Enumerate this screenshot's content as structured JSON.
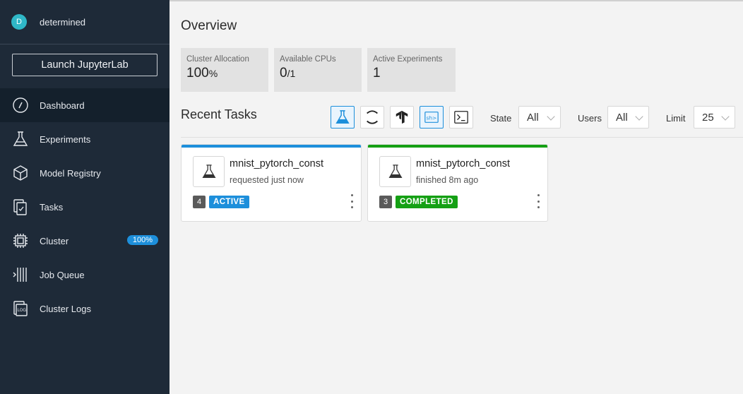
{
  "user": {
    "initial": "D",
    "name": "determined"
  },
  "launch_button": "Launch JupyterLab",
  "nav": [
    {
      "label": "Dashboard",
      "icon": "dashboard-icon",
      "active": true
    },
    {
      "label": "Experiments",
      "icon": "flask-icon"
    },
    {
      "label": "Model Registry",
      "icon": "cube-icon"
    },
    {
      "label": "Tasks",
      "icon": "tasks-icon"
    },
    {
      "label": "Cluster",
      "icon": "chip-icon",
      "badge": "100%"
    },
    {
      "label": "Job Queue",
      "icon": "queue-icon"
    },
    {
      "label": "Cluster Logs",
      "icon": "logs-icon"
    }
  ],
  "overview": {
    "title": "Overview",
    "stats": [
      {
        "label": "Cluster Allocation",
        "value": "100",
        "suffix": "%"
      },
      {
        "label": "Available CPUs",
        "value": "0",
        "suffix": "/1"
      },
      {
        "label": "Active Experiments",
        "value": "1",
        "suffix": ""
      }
    ]
  },
  "recent": {
    "title": "Recent Tasks",
    "type_filters": [
      "experiment-icon",
      "notebook-icon",
      "tensorboard-icon",
      "shell-icon",
      "command-icon"
    ],
    "filters": {
      "state_label": "State",
      "state_value": "All",
      "users_label": "Users",
      "users_value": "All",
      "limit_label": "Limit",
      "limit_value": "25"
    },
    "tasks": [
      {
        "title": "mnist_pytorch_const",
        "subtitle": "requested just now",
        "count": "4",
        "status": "ACTIVE",
        "color": "#1d8fdb"
      },
      {
        "title": "mnist_pytorch_const",
        "subtitle": "finished 8m ago",
        "count": "3",
        "status": "COMPLETED",
        "color": "#15a014"
      }
    ]
  }
}
